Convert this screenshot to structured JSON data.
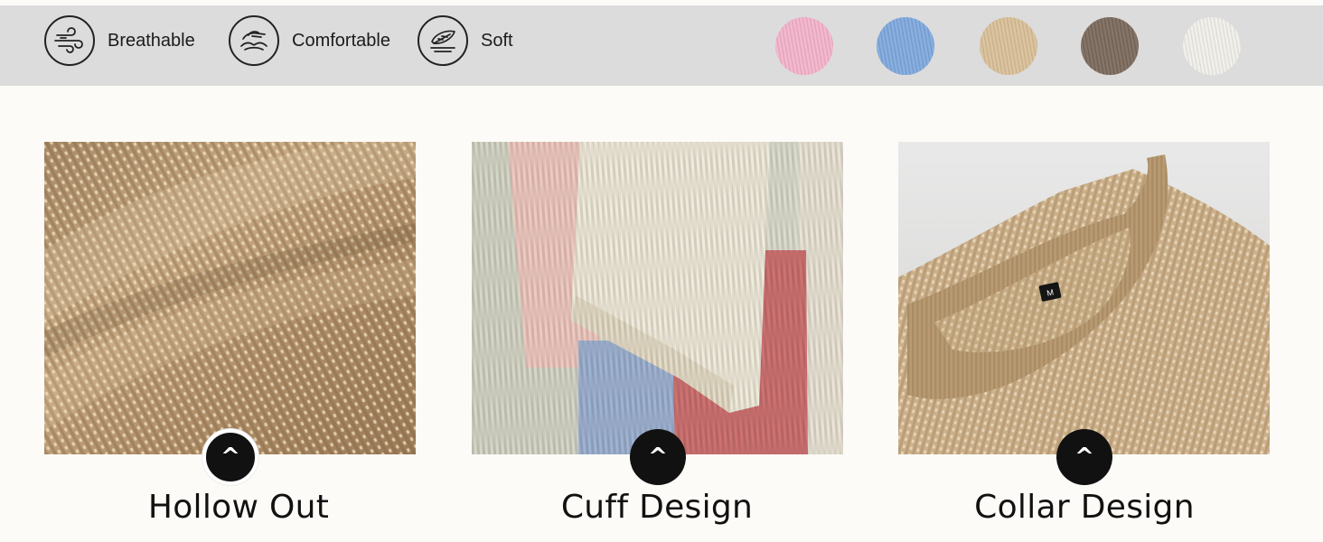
{
  "features": [
    {
      "label": "Breathable",
      "icon": "wind-icon"
    },
    {
      "label": "Comfortable",
      "icon": "hand-cloud-icon"
    },
    {
      "label": "Soft",
      "icon": "feather-icon"
    }
  ],
  "swatches": [
    {
      "name": "pink",
      "color": "#f3b2cb"
    },
    {
      "name": "blue",
      "color": "#7fa8de"
    },
    {
      "name": "beige",
      "color": "#d9bf98"
    },
    {
      "name": "brown",
      "color": "#7b695c"
    },
    {
      "name": "white",
      "color": "#f1efe9"
    }
  ],
  "panels": [
    {
      "caption": "Hollow Out",
      "badge": "^"
    },
    {
      "caption": "Cuff Design",
      "badge": "^"
    },
    {
      "caption": "Collar Design",
      "badge": "^"
    }
  ],
  "collar_tag": "M"
}
